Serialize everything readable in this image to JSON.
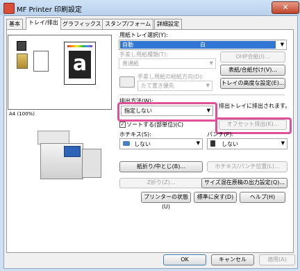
{
  "window": {
    "title": "MF Printer 印刷設定",
    "close_label": "✕"
  },
  "tabs": [
    "基本",
    "トレイ/排出",
    "グラフィックス",
    "スタンプ/フォーム",
    "詳細設定"
  ],
  "preview": {
    "paper_caption": "A4 (100%)",
    "page_letter": "a"
  },
  "paper_tray": {
    "label": "用紙トレイ選択(Y):",
    "value": "自動",
    "value_right": "白",
    "paper_type_label": "手差し用紙種類(T):",
    "paper_type_value": "普通紙",
    "ohp_button": "OHP合紙(I)...",
    "cover_button": "表紙/合紙付け(V)...",
    "feed_direction_label": "手差し用紙の給紙方向(D):",
    "feed_direction_value": "たて置き優先",
    "tray_advanced_button": "トレイの高度な設定(E)..."
  },
  "output": {
    "label": "排出方法(W):",
    "value": "指定しない",
    "info": "排出トレイに排出されます。",
    "sort_label": "ソートする(部単位)(C)",
    "sort_checked": true,
    "offset_button": "オフセット排出(K)...",
    "staple_label": "ホチキス(S):",
    "staple_value": "しない",
    "punch_label": "パンチ(P):",
    "punch_value": "しない",
    "fold_button": "紙折り/中とじ(B)...",
    "punch_position_button": "ホチキス/パンチ位置(L)...",
    "zfold_button": "Z折り(Z)...",
    "mixed_size_button": "サイズ混在原稿の出力設定(Q)..."
  },
  "panel_buttons": {
    "printer_status": "プリンターの状態(U)",
    "defaults": "標準に戻す(D)",
    "help": "ヘルプ(H)"
  },
  "dialog_buttons": {
    "ok": "OK",
    "cancel": "キャンセル",
    "apply": "適用(A)"
  }
}
